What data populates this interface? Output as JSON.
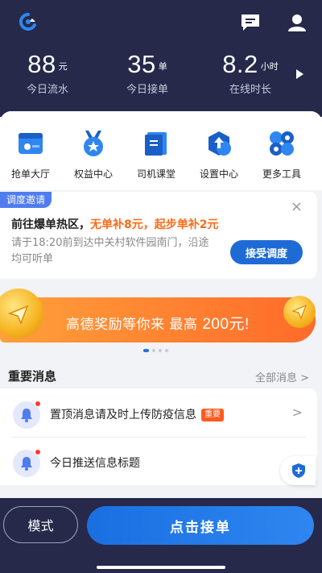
{
  "header": {
    "logo_icon": "app-logo-icon",
    "message_icon": "chat-icon",
    "profile_icon": "user-icon"
  },
  "stats": [
    {
      "value": "88",
      "unit": "元",
      "label": "今日流水"
    },
    {
      "value": "35",
      "unit": "单",
      "label": "今日接单"
    },
    {
      "value": "8.2",
      "unit": "小时",
      "label": "在线时长"
    }
  ],
  "quick_menu": [
    {
      "label": "抢单大厅",
      "icon": "grab-hall-icon"
    },
    {
      "label": "权益中心",
      "icon": "medal-icon"
    },
    {
      "label": "司机课堂",
      "icon": "book-icon"
    },
    {
      "label": "设置中心",
      "icon": "settings-icon"
    },
    {
      "label": "更多工具",
      "icon": "more-tools-icon"
    }
  ],
  "invite": {
    "tag": "调度邀请",
    "title_prefix": "前往爆单热区，",
    "title_highlight": "无单补8元，起步单补2元",
    "desc": "请于18:20前到达中关村软件园南门，沿途均可听单",
    "accept_label": "接受调度",
    "close": "×"
  },
  "banner": {
    "text": "高德奖励等你来 最高",
    "amount": "200元!"
  },
  "messages": {
    "title": "重要消息",
    "more": "全部消息 >",
    "items": [
      {
        "text": "置顶消息请及时上传防疫信息",
        "badge": "重要",
        "chevron": ">"
      },
      {
        "text": "今日推送信息标题",
        "badge": "",
        "chevron": ""
      }
    ]
  },
  "bottom": {
    "mode_label": "模式",
    "grab_label": "点击接单"
  },
  "colors": {
    "dark_bg": "#26294a",
    "accent_blue": "#1f6bd6",
    "highlight_orange": "#ff6a16",
    "badge_red": "#ff5a1f"
  }
}
